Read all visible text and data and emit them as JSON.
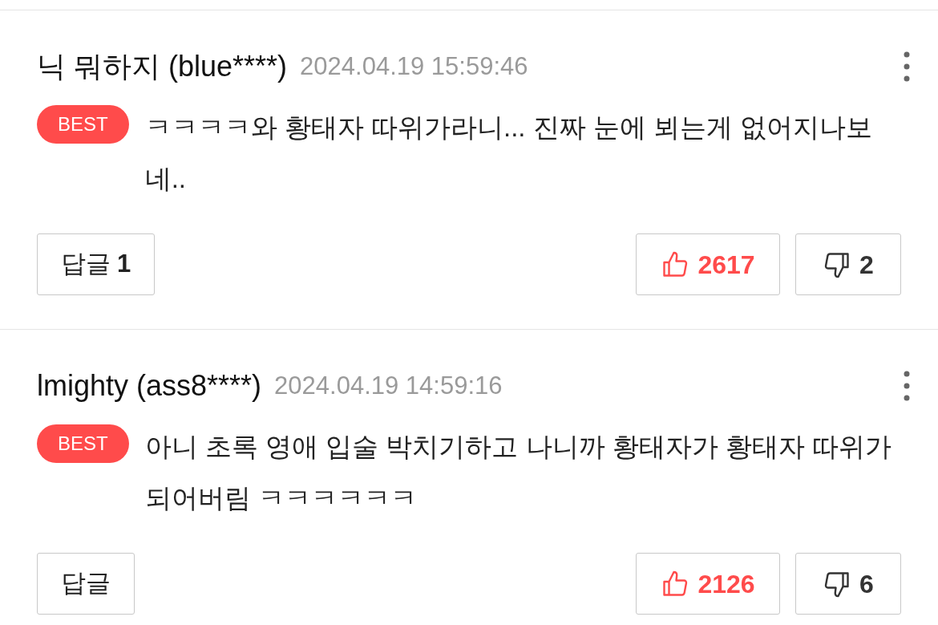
{
  "comments": [
    {
      "nickname": "닉 뭐하지 (blue****)",
      "date": "2024.04.19 15:59:46",
      "badge": "BEST",
      "text": "ㅋㅋㅋㅋ와 황태자 따위가라니... 진짜 눈에 뵈는게 없어지나보네..",
      "reply_label": "답글",
      "reply_count": "1",
      "likes": "2617",
      "dislikes": "2"
    },
    {
      "nickname": "lmighty (ass8****)",
      "date": "2024.04.19 14:59:16",
      "badge": "BEST",
      "text": "아니 초록 영애 입술 박치기하고 나니까 황태자가 황태자 따위가 되어버림 ㅋㅋㅋㅋㅋㅋ",
      "reply_label": "답글",
      "likes": "2126",
      "dislikes": "6"
    }
  ]
}
